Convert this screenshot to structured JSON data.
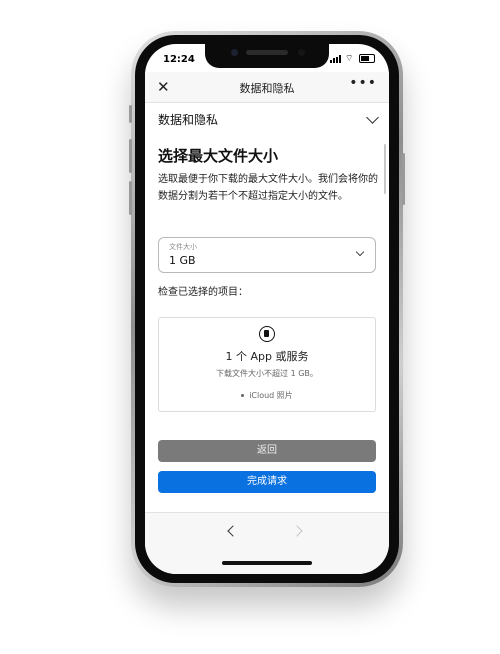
{
  "status_bar": {
    "time": "12:24"
  },
  "nav": {
    "close_icon": "close-icon",
    "title": "数据和隐私",
    "more_label": "•••"
  },
  "section": {
    "title": "数据和隐私"
  },
  "page": {
    "heading": "选择最大文件大小",
    "description": "选取最便于你下载的最大文件大小。我们会将你的数据分割为若干个不超过指定大小的文件。",
    "file_size": {
      "label": "文件大小",
      "value": "1 GB"
    },
    "review_label": "检查已选择的项目：",
    "summary_card": {
      "icon": "document-icon",
      "title": "1 个 App 或服务",
      "subtitle": "下载文件大小不超过 1 GB。",
      "items": [
        "iCloud 照片"
      ]
    },
    "back_button": "返回",
    "done_button": "完成请求"
  },
  "colors": {
    "accent": "#0a71e0",
    "back_button": "#7a7a7a"
  }
}
